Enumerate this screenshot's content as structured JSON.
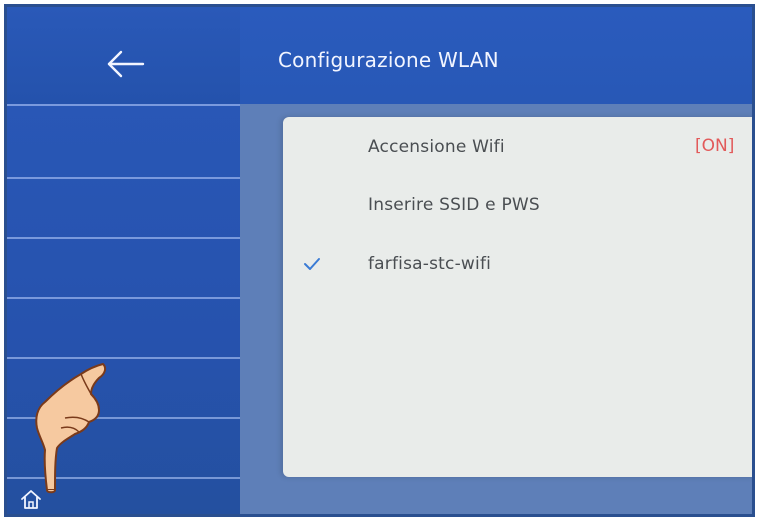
{
  "header": {
    "title": "Configurazione WLAN",
    "back_icon": "arrow-left-icon"
  },
  "settings": {
    "items": [
      {
        "label": "Accensione Wifi",
        "status": "[ON]"
      },
      {
        "label": "Inserire SSID e PWS"
      },
      {
        "label": "farfisa-stc-wifi",
        "selected": true
      }
    ]
  },
  "sidebar": {
    "home_icon": "home-icon",
    "pointer": "pointing-hand-icon"
  },
  "colors": {
    "header_blue": "#2a59b8",
    "panel_bg": "#e9ecea",
    "status_red": "#e25a5a",
    "check_blue": "#3a7bd5"
  }
}
